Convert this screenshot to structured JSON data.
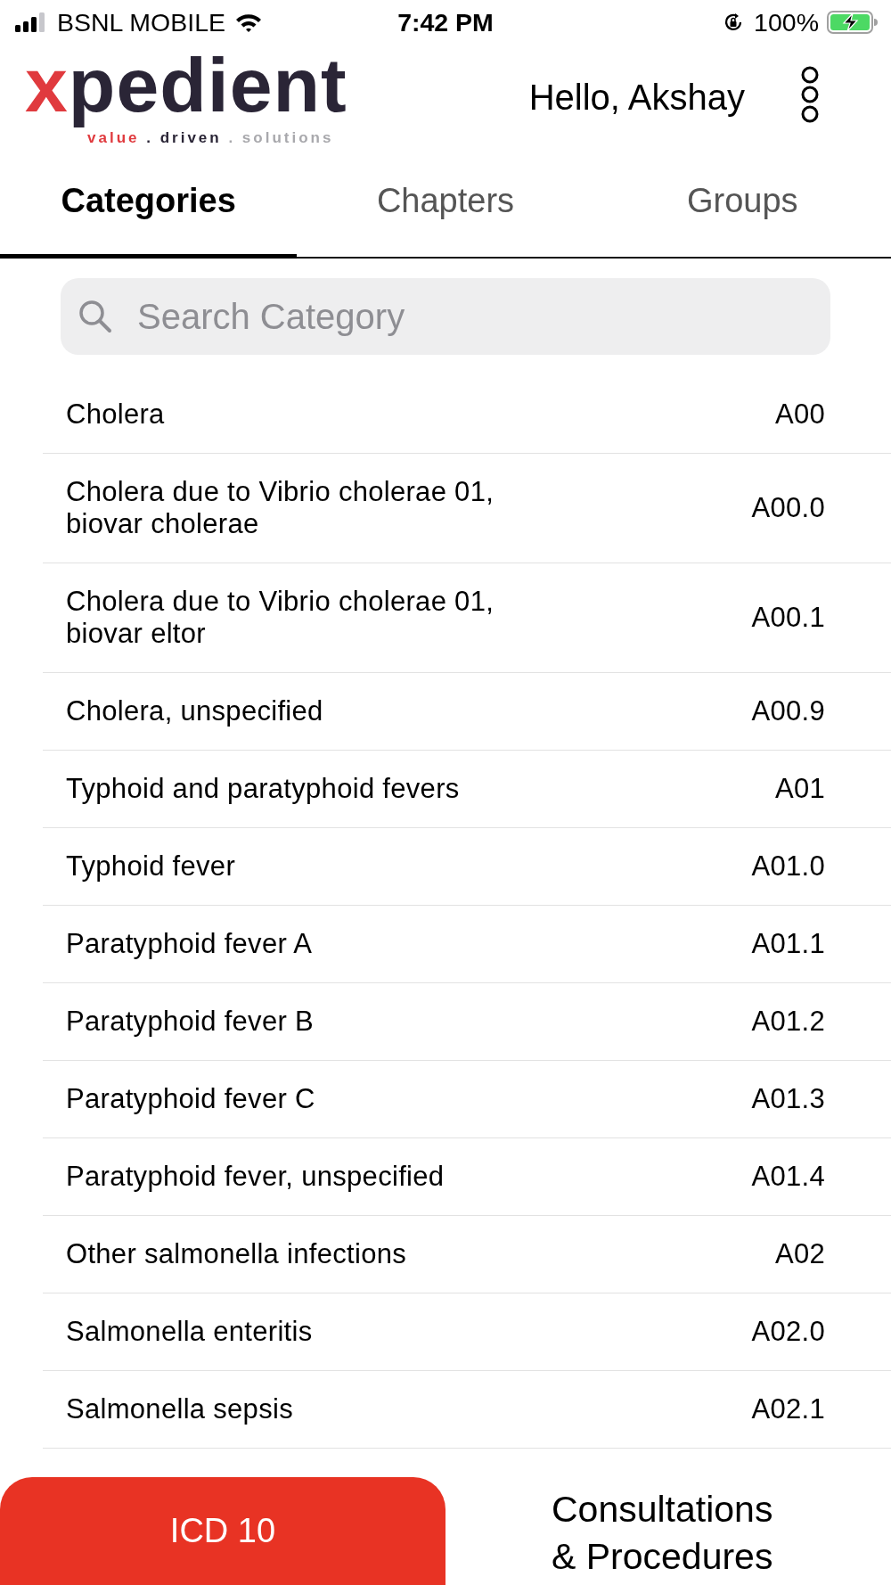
{
  "status_bar": {
    "carrier": "BSNL MOBILE",
    "time": "7:42 PM",
    "battery": "100%"
  },
  "header": {
    "logo": {
      "wordmark": [
        {
          "text": "x",
          "color": "#e03a3e"
        },
        {
          "text": "pedient",
          "color": "#2a2536"
        }
      ],
      "tagline": [
        {
          "text": "value",
          "color": "#e03a3e"
        },
        {
          "text": ". driven",
          "color": "#2a2536"
        },
        {
          "text": ". solutions",
          "color": "#a9a9ad"
        }
      ]
    },
    "greeting": "Hello, Akshay"
  },
  "tabs": [
    {
      "label": "Categories",
      "selected": true
    },
    {
      "label": "Chapters",
      "selected": false
    },
    {
      "label": "Groups",
      "selected": false
    }
  ],
  "search": {
    "placeholder": "Search Category"
  },
  "categories": [
    {
      "name": "Cholera",
      "code": "A00"
    },
    {
      "name": "Cholera due to Vibrio cholerae 01, biovar cholerae",
      "code": "A00.0"
    },
    {
      "name": "Cholera due to Vibrio cholerae 01, biovar eltor",
      "code": "A00.1"
    },
    {
      "name": "Cholera, unspecified",
      "code": "A00.9"
    },
    {
      "name": "Typhoid and paratyphoid fevers",
      "code": "A01"
    },
    {
      "name": "Typhoid fever",
      "code": "A01.0"
    },
    {
      "name": "Paratyphoid fever A",
      "code": "A01.1"
    },
    {
      "name": "Paratyphoid fever B",
      "code": "A01.2"
    },
    {
      "name": "Paratyphoid fever C",
      "code": "A01.3"
    },
    {
      "name": "Paratyphoid fever, unspecified",
      "code": "A01.4"
    },
    {
      "name": "Other salmonella infections",
      "code": "A02"
    },
    {
      "name": "Salmonella enteritis",
      "code": "A02.0"
    },
    {
      "name": "Salmonella sepsis",
      "code": "A02.1"
    }
  ],
  "bottom_tabs": [
    {
      "label": "ICD 10",
      "selected": true
    },
    {
      "label": "Consultations & Procedures",
      "selected": false
    }
  ]
}
